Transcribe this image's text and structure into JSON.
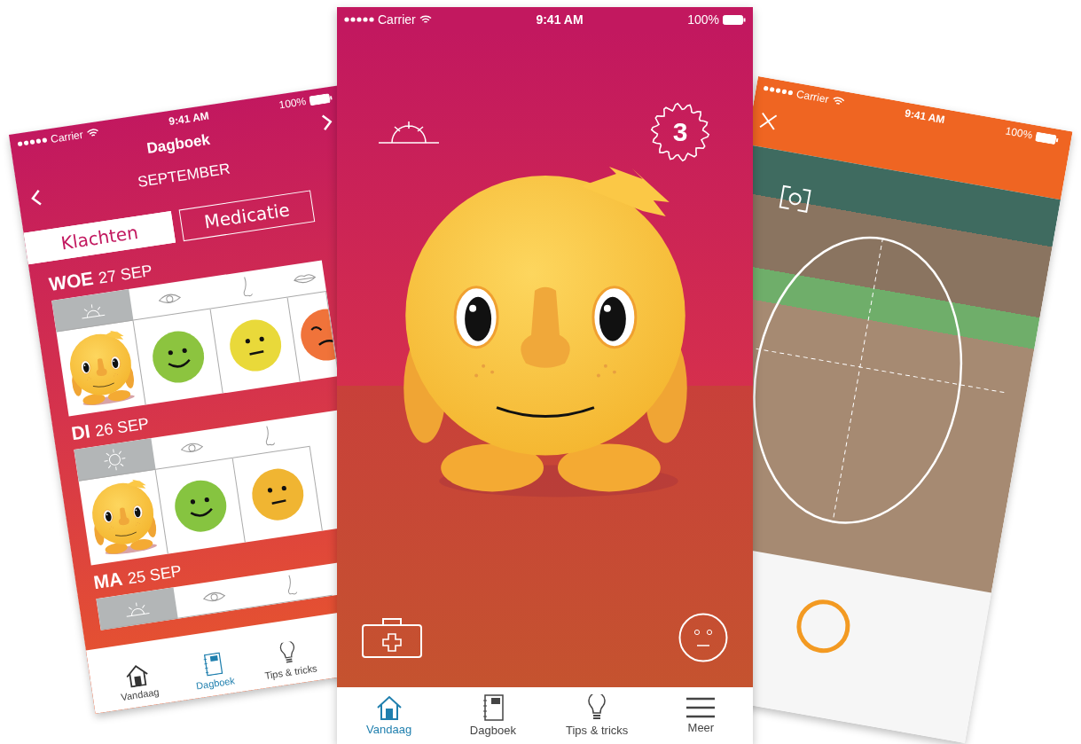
{
  "left_phone": {
    "status_bar": {
      "carrier": "Carrier",
      "time": "9:41 AM",
      "battery": "100%"
    },
    "title": "Dagboek",
    "month": "SEPTEMBER",
    "tabs": [
      {
        "label": "Klachten",
        "selected": true
      },
      {
        "label": "Medicatie",
        "selected": false
      }
    ],
    "days": [
      {
        "weekday": "WOE",
        "date": "27 SEP",
        "header": [
          {
            "kind": "sunrise"
          },
          {
            "kind": "eye"
          },
          {
            "kind": "nose"
          },
          {
            "kind": "lips"
          }
        ],
        "moods": [
          {
            "kind": "mascot"
          },
          {
            "kind": "happy",
            "color": "#8cc43f"
          },
          {
            "kind": "neutral",
            "color": "#e9d93a"
          },
          {
            "kind": "sad",
            "color": "#f0733a"
          }
        ]
      },
      {
        "weekday": "DI",
        "date": "26 SEP",
        "header": [
          {
            "kind": "sun"
          },
          {
            "kind": "eye"
          },
          {
            "kind": "nose"
          }
        ],
        "moods": [
          {
            "kind": "mascot"
          },
          {
            "kind": "happy",
            "color": "#86c440"
          },
          {
            "kind": "neutral",
            "color": "#f0b532"
          }
        ]
      },
      {
        "weekday": "MA",
        "date": "25 SEP",
        "header": [
          {
            "kind": "sunrise"
          },
          {
            "kind": "eye"
          },
          {
            "kind": "nose"
          }
        ]
      }
    ],
    "tab_bar": [
      {
        "label": "Vandaag",
        "kind": "home",
        "selected": false
      },
      {
        "label": "Dagboek",
        "kind": "diary",
        "selected": true
      },
      {
        "label": "Tips & tricks",
        "kind": "tips",
        "selected": false
      }
    ]
  },
  "center_phone": {
    "status_bar": {
      "carrier": "Carrier",
      "time": "9:41 AM",
      "battery": "100%"
    },
    "streak": "3",
    "tab_bar": [
      {
        "label": "Vandaag",
        "kind": "home",
        "selected": true
      },
      {
        "label": "Dagboek",
        "kind": "diary",
        "selected": false
      },
      {
        "label": "Tips & tricks",
        "kind": "tips",
        "selected": false
      },
      {
        "label": "Meer",
        "kind": "menu",
        "selected": false
      }
    ]
  },
  "right_phone": {
    "status_bar": {
      "carrier": "Carrier",
      "time": "9:41 AM",
      "battery": "100%"
    }
  }
}
